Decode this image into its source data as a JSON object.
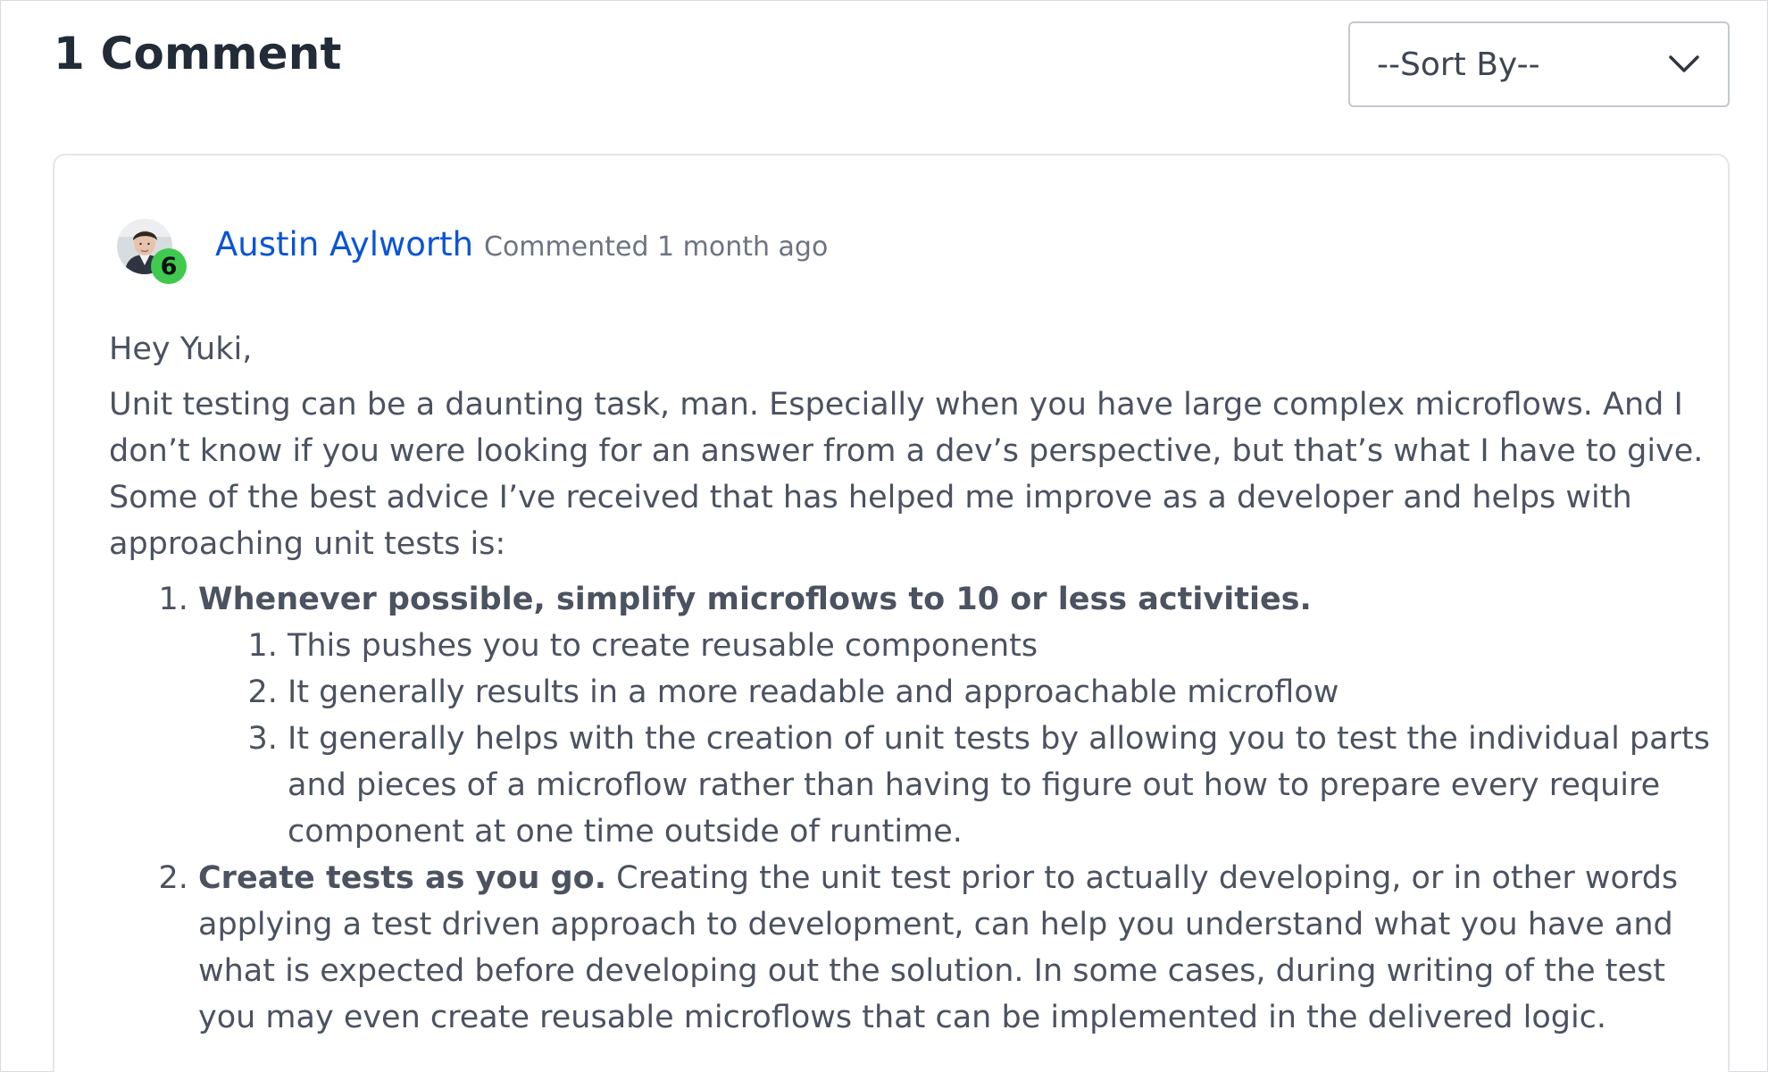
{
  "comments_header": {
    "title": "1 Comment",
    "sort_dropdown": {
      "selected": "--Sort By--",
      "icon": "chevron-down-icon"
    }
  },
  "comment": {
    "author": "Austin Aylworth",
    "reputation_badge": "6",
    "meta": "Commented 1 month ago",
    "body": {
      "greeting": "Hey Yuki,",
      "intro": "Unit testing can be a daunting task, man. Especially when you have large complex microflows. And I don’t know if you were looking for an answer from a dev’s perspective, but that’s what I have to give. Some of the best advice I’ve received that has helped me improve as a developer and helps with approaching unit tests is:",
      "points": [
        {
          "bold": "Whenever possible, simplify microflows to 10 or less activities.",
          "text": "",
          "subpoints": [
            "This pushes you to create reusable components",
            "It generally results in a more readable and approachable microflow",
            "It generally helps with the creation of unit tests by allowing you to test the individual parts and pieces of a microflow rather than having to figure out how to prepare every require component at one time outside of runtime."
          ]
        },
        {
          "bold": "Create tests as you go.",
          "text": " Creating the unit test prior to actually developing, or in other words applying a test driven approach to development, can help you understand what you have and what is expected before developing out the solution. In some cases, during writing of the test you may even create reusable microflows that can be implemented in the delivered logic."
        }
      ]
    }
  },
  "colors": {
    "author_link": "#0b54d8",
    "badge_green": "#3fca4f",
    "heading": "#222b38",
    "body_text": "#4b5260"
  }
}
